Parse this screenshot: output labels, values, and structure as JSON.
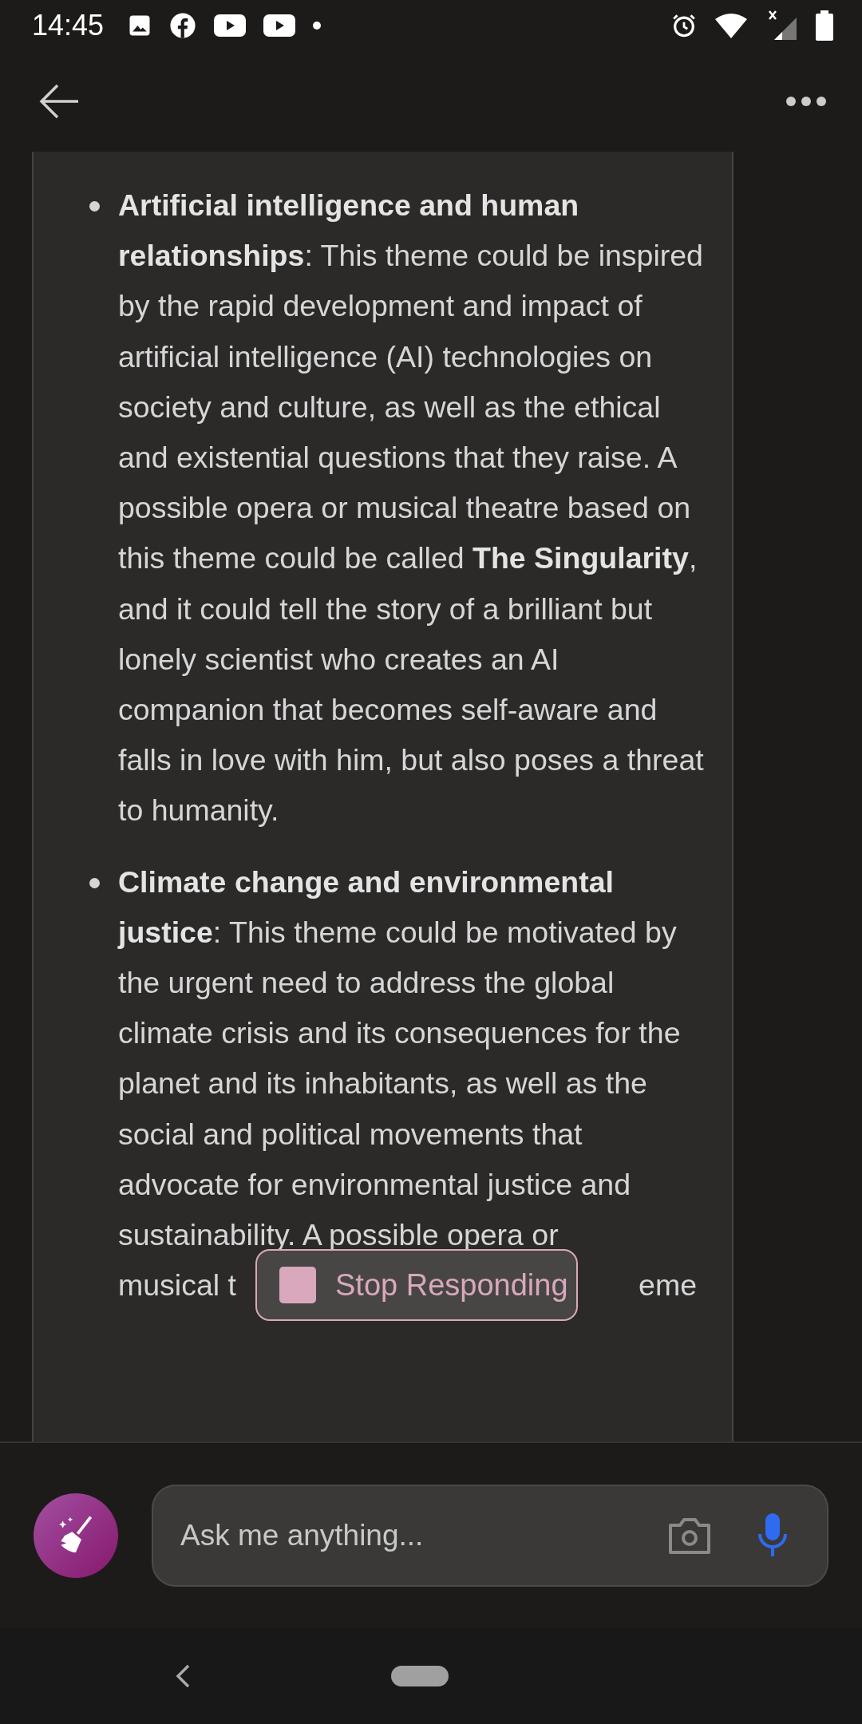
{
  "status_bar": {
    "time": "14:45"
  },
  "bullets": [
    {
      "text": "**Artificial intelligence and human relationships**: This theme could be inspired by the rapid development and impact of artificial intelligence (AI) technologies on society and culture, as well as the ethical and existential questions that they raise. A possible opera or musical theatre based on this theme could be called **The Singularity**, and it could tell the story of a brilliant but lonely scientist who creates an AI companion that becomes self-aware and falls in love with him, but also poses a threat to humanity."
    },
    {
      "text": "**Climate change and environmental justice**: This theme could be motivated by the urgent need to address the global climate crisis and its consequences for the planet and its inhabitants, as well as the social and political movements that advocate for environmental justice and sustainability. A possible opera or",
      "covered_line": {
        "before": "musical t",
        "after": "eme"
      }
    }
  ],
  "stop_button": {
    "label": "Stop Responding"
  },
  "input": {
    "placeholder": "Ask me anything..."
  }
}
